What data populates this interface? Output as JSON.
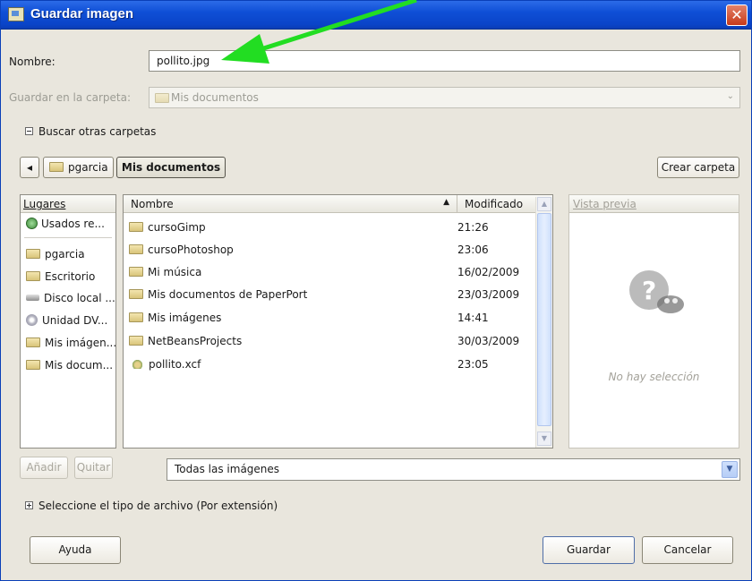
{
  "window": {
    "title": "Guardar imagen",
    "close_glyph": "✕",
    "icon": "gimp-icon"
  },
  "name_field": {
    "label": "Nombre:",
    "value": "pollito.jpg"
  },
  "save_in": {
    "label": "Guardar en la carpeta:",
    "value": "Mis documentos"
  },
  "browse": {
    "label": "Buscar otras carpetas"
  },
  "path_bar": {
    "back_glyph": "◂",
    "crumbs": [
      "pgarcia",
      "Mis documentos"
    ],
    "create_folder": "Crear carpeta"
  },
  "places": {
    "header": "Lugares",
    "items": [
      {
        "label": "Usados re...",
        "icon": "recent-icon"
      },
      {
        "label": "pgarcia",
        "icon": "folder-icon"
      },
      {
        "label": "Escritorio",
        "icon": "folder-icon"
      },
      {
        "label": "Disco local ...",
        "icon": "harddisk-icon"
      },
      {
        "label": "Unidad DV...",
        "icon": "dvd-icon"
      },
      {
        "label": "Mis imágen...",
        "icon": "folder-icon"
      },
      {
        "label": "Mis docum...",
        "icon": "folder-icon"
      }
    ]
  },
  "files": {
    "col_name": "Nombre",
    "col_modified": "Modificado",
    "sort_glyph": "▲",
    "rows": [
      {
        "name": "cursoGimp",
        "modified": "21:26",
        "icon": "folder-icon"
      },
      {
        "name": "cursoPhotoshop",
        "modified": "23:06",
        "icon": "folder-icon"
      },
      {
        "name": "Mi música",
        "modified": "16/02/2009",
        "icon": "folder-icon"
      },
      {
        "name": "Mis documentos de PaperPort",
        "modified": "23/03/2009",
        "icon": "folder-icon"
      },
      {
        "name": "Mis imágenes",
        "modified": "14:41",
        "icon": "folder-icon"
      },
      {
        "name": "NetBeansProjects",
        "modified": "30/03/2009",
        "icon": "folder-icon"
      },
      {
        "name": "pollito.xcf",
        "modified": "23:05",
        "icon": "xcf-file-icon"
      }
    ]
  },
  "preview": {
    "header": "Vista previa",
    "empty": "No hay selección"
  },
  "add_button": "Añadir",
  "remove_button": "Quitar",
  "filter": {
    "value": "Todas las imágenes"
  },
  "file_type": {
    "label": "Seleccione el tipo de archivo (Por extensión)"
  },
  "buttons": {
    "help": "Ayuda",
    "save": "Guardar",
    "cancel": "Cancelar"
  },
  "colors": {
    "titlebar": "#0a44c8",
    "dialog_bg": "#e9e6dd",
    "annotation_arrow": "#22dd22"
  }
}
